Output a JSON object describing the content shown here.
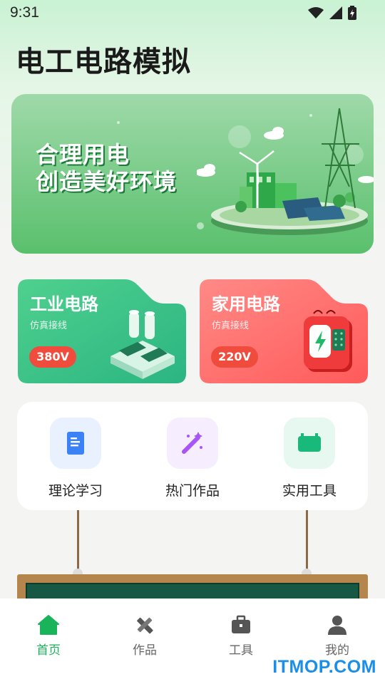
{
  "status_bar": {
    "time": "9:31"
  },
  "app_title": "电工电路模拟",
  "banner": {
    "line1": "合理用电",
    "line2": "创造美好环境"
  },
  "circuit_cards": [
    {
      "title": "工业电路",
      "subtitle": "仿真接线",
      "voltage": "380V",
      "color": "#3cc387"
    },
    {
      "title": "家用电路",
      "subtitle": "仿真接线",
      "voltage": "220V",
      "color": "#ff6a6a"
    }
  ],
  "quick_links": [
    {
      "label": "理论学习",
      "icon": "document-icon",
      "color": "#3b82f6"
    },
    {
      "label": "热门作品",
      "icon": "magic-wand-icon",
      "color": "#a855f7"
    },
    {
      "label": "实用工具",
      "icon": "toolbox-icon",
      "color": "#18b97a"
    }
  ],
  "bottom_nav": [
    {
      "label": "首页",
      "icon": "home-icon",
      "active": true
    },
    {
      "label": "作品",
      "icon": "pencil-ruler-icon",
      "active": false
    },
    {
      "label": "工具",
      "icon": "briefcase-icon",
      "active": false
    },
    {
      "label": "我的",
      "icon": "user-icon",
      "active": false
    }
  ],
  "watermark": "ITMOP.COM",
  "colors": {
    "primary": "#19b35a",
    "volt_badge": "#f04c3e"
  }
}
